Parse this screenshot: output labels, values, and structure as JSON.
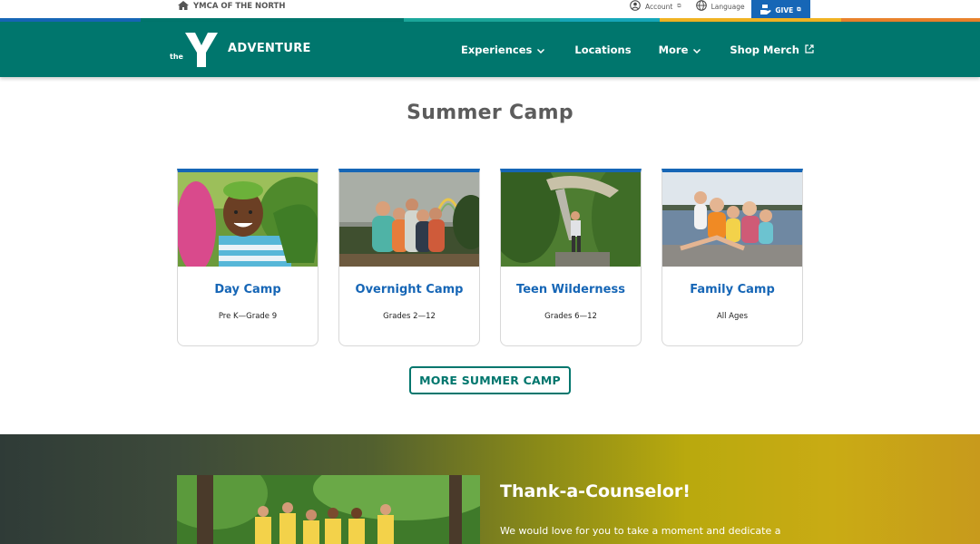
{
  "utility": {
    "brand": "YMCA OF THE NORTH",
    "account_label": "Account",
    "language_label": "Language",
    "give_label": "GIVE"
  },
  "nav": {
    "logo_the": "the",
    "brand_name": "ADVENTURE",
    "items": [
      {
        "label": "Experiences",
        "has_dropdown": true
      },
      {
        "label": "Locations",
        "has_dropdown": false
      },
      {
        "label": "More",
        "has_dropdown": true
      },
      {
        "label": "Shop Merch",
        "external": true
      }
    ]
  },
  "colors": {
    "teal": "#00766d",
    "blue": "#1666b6",
    "title_gray": "#5c5c5c"
  },
  "summer_camp": {
    "title": "Summer Camp",
    "cards": [
      {
        "title": "Day Camp",
        "subtitle": "Pre K—Grade 9"
      },
      {
        "title": "Overnight Camp",
        "subtitle": "Grades 2—12"
      },
      {
        "title": "Teen Wilderness",
        "subtitle": "Grades 6—12"
      },
      {
        "title": "Family Camp",
        "subtitle": "All Ages"
      }
    ],
    "more_button": "MORE SUMMER CAMP"
  },
  "feature": {
    "title": "Thank-a-Counselor!",
    "text": "We would love for you to take a moment and dedicate a"
  }
}
